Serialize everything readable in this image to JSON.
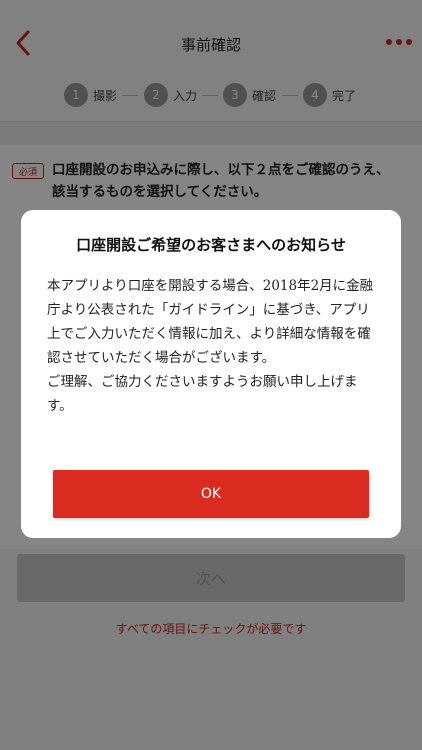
{
  "header": {
    "title": "事前確認"
  },
  "steps": [
    {
      "num": "1",
      "label": "撮影"
    },
    {
      "num": "2",
      "label": "入力"
    },
    {
      "num": "3",
      "label": "確認"
    },
    {
      "num": "4",
      "label": "完了"
    }
  ],
  "requirement": {
    "badge": "必須",
    "text": "口座開設のお申込みに際し、以下２点をご確認のうえ、該当するものを選択してください。"
  },
  "footer": {
    "next_label": "次へ",
    "hint": "すべての項目にチェックが必要です"
  },
  "modal": {
    "title": "口座開設ご希望のお客さまへのお知らせ",
    "paragraph1": "本アプリより口座を開設する場合、2018年2月に金融庁より公表された「ガイドライン」に基づき、アプリ上でご入力いただく情報に加え、より詳細な情報を確認させていただく場合がございます。",
    "paragraph2": "ご理解、ご協力くださいますようお願い申し上げます。",
    "ok_label": "OK"
  },
  "colors": {
    "accent": "#c62828",
    "ok_button": "#db2b20",
    "disabled_button": "#c9c9c9"
  }
}
